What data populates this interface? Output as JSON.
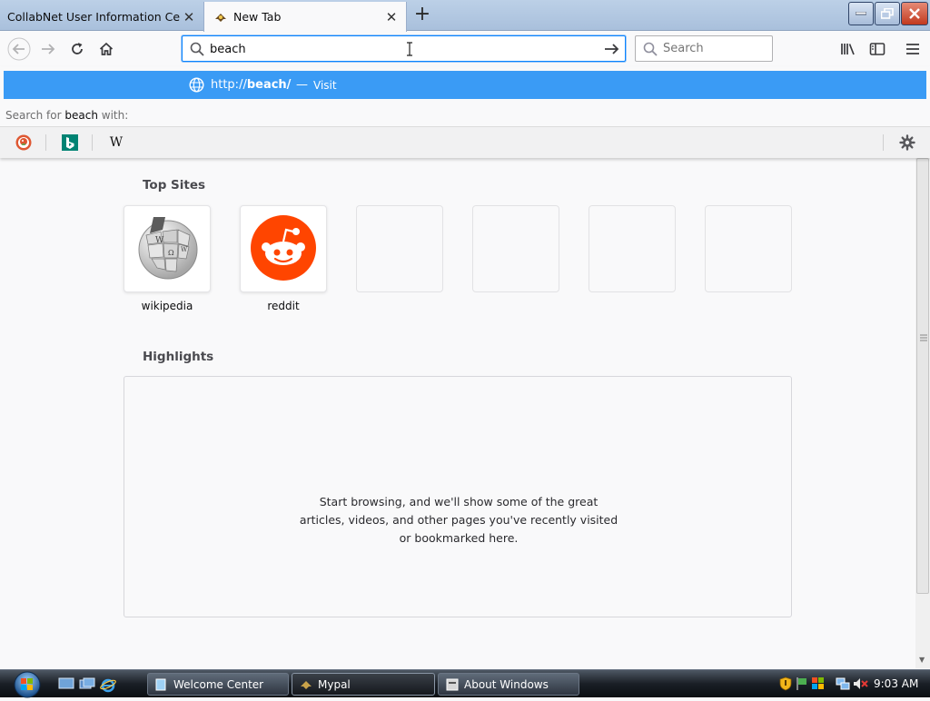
{
  "tabs": [
    {
      "label": "CollabNet User Information Center",
      "active": false
    },
    {
      "label": "New Tab",
      "active": true
    }
  ],
  "toolbar": {
    "url_value": "beach",
    "search_placeholder": "Search"
  },
  "dropdown": {
    "visit_url_prefix": "http://",
    "visit_url_host": "beach/",
    "visit_sep": "—",
    "visit_label": "Visit",
    "search_with_prefix": "Search for",
    "search_with_term": "beach",
    "search_with_suffix": "with:",
    "engines": [
      "duckduckgo-icon",
      "bing-icon",
      "wikipedia-icon"
    ]
  },
  "content": {
    "top_sites_title": "Top Sites",
    "top_sites": [
      {
        "label": "wikipedia",
        "icon": "wikipedia-globe-icon"
      },
      {
        "label": "reddit",
        "icon": "reddit-icon"
      },
      {
        "label": ""
      },
      {
        "label": ""
      },
      {
        "label": ""
      },
      {
        "label": ""
      }
    ],
    "highlights_title": "Highlights",
    "highlights_empty_message": "Start browsing, and we'll show some of the great articles, videos, and other pages you've recently visited or bookmarked here."
  },
  "taskbar": {
    "tasks": [
      {
        "label": "Welcome Center",
        "active": false
      },
      {
        "label": "Mypal",
        "active": true
      },
      {
        "label": "About Windows",
        "active": false
      }
    ],
    "time": "9:03 AM"
  },
  "colors": {
    "accent_blue": "#0a84ff",
    "visit_row_blue": "#3a9bf5",
    "reddit_orange": "#ff4500"
  }
}
